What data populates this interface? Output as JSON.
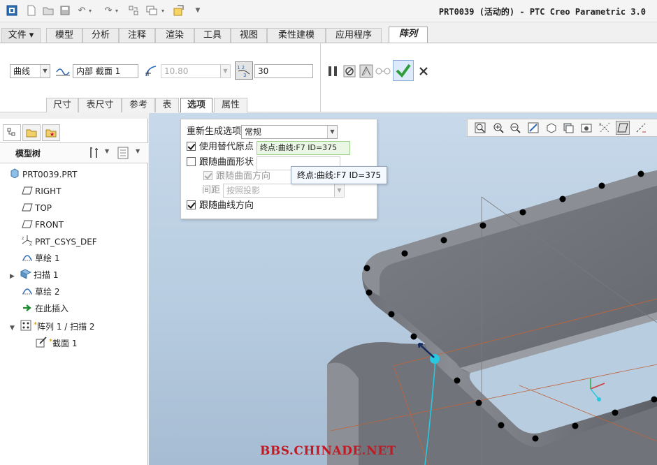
{
  "window": {
    "title": "PRT0039 (活动的) - PTC Creo Parametric 3.0"
  },
  "tabs": [
    {
      "label": "文件 ▾"
    },
    {
      "label": "模型"
    },
    {
      "label": "分析"
    },
    {
      "label": "注释"
    },
    {
      "label": "渲染"
    },
    {
      "label": "工具"
    },
    {
      "label": "视图"
    },
    {
      "label": "柔性建模"
    },
    {
      "label": "应用程序"
    },
    {
      "label": "阵列"
    }
  ],
  "ribbon": {
    "pattern_type": "曲线",
    "reference_value": "内部 截面 1",
    "spacing_value": "10.80",
    "count_value": "30",
    "subtabs": [
      "尺寸",
      "表尺寸",
      "参考",
      "表",
      "选项",
      "属性"
    ],
    "active_subtab": "选项"
  },
  "left_panel": {
    "header": "模型树",
    "items": [
      {
        "label": "PRT0039.PRT",
        "icon": "part-icon",
        "indent": 0
      },
      {
        "label": "RIGHT",
        "icon": "datum-plane-icon",
        "indent": 1
      },
      {
        "label": "TOP",
        "icon": "datum-plane-icon",
        "indent": 1
      },
      {
        "label": "FRONT",
        "icon": "datum-plane-icon",
        "indent": 1
      },
      {
        "label": "PRT_CSYS_DEF",
        "icon": "csys-icon",
        "indent": 1
      },
      {
        "label": "草绘 1",
        "icon": "sketch-icon",
        "indent": 1
      },
      {
        "label": "扫描 1",
        "icon": "sweep-icon",
        "indent": 1,
        "expandable": true
      },
      {
        "label": "草绘 2",
        "icon": "sketch-icon",
        "indent": 1
      },
      {
        "label": "在此插入",
        "icon": "insert-arrow-icon",
        "indent": 1
      },
      {
        "label": "阵列 1 / 扫描 2",
        "icon": "pattern-icon",
        "indent": 1,
        "expandable": true,
        "expanded": true
      },
      {
        "label": "截面 1",
        "icon": "section-icon",
        "indent": 2
      }
    ]
  },
  "options_panel": {
    "regen_label": "重新生成选项",
    "regen_value": "常规",
    "use_alt_origin_label": "使用替代原点",
    "use_alt_origin_checked": true,
    "alt_origin_value": "终点:曲线:F7 ID=375",
    "follow_surface_shape_label": "跟随曲面形状",
    "follow_surface_shape_checked": false,
    "follow_surface_dir_label": "跟随曲面方向",
    "follow_surface_dir_checked": true,
    "spacing_label": "间距",
    "spacing_value": "按照投影",
    "follow_curve_dir_label": "跟随曲线方向",
    "follow_curve_dir_checked": true
  },
  "tooltip": {
    "text": "终点:曲线:F7 ID=375"
  },
  "watermark": "BBS.CHINADE.NET",
  "colors": {
    "accent_green": "#2f9e3a",
    "watermark": "#c11a24",
    "viewport_top": "#c7d9ea"
  }
}
